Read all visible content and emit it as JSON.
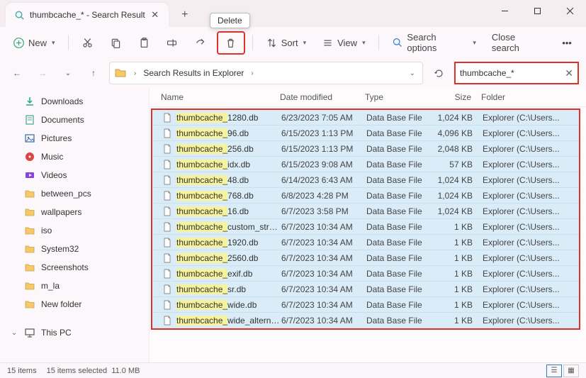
{
  "window": {
    "tab_title": "thumbcache_* - Search Result",
    "tooltip_delete": "Delete"
  },
  "toolbar": {
    "new": "New",
    "sort": "Sort",
    "view": "View",
    "search_options": "Search options",
    "close_search": "Close search"
  },
  "address": {
    "breadcrumb": "Search Results in Explorer",
    "search_query": "thumbcache_*"
  },
  "columns": {
    "name": "Name",
    "date": "Date modified",
    "type": "Type",
    "size": "Size",
    "folder": "Folder"
  },
  "sidebar": [
    {
      "label": "Downloads",
      "icon": "download"
    },
    {
      "label": "Documents",
      "icon": "doc"
    },
    {
      "label": "Pictures",
      "icon": "pic"
    },
    {
      "label": "Music",
      "icon": "music"
    },
    {
      "label": "Videos",
      "icon": "video"
    },
    {
      "label": "between_pcs",
      "icon": "folder"
    },
    {
      "label": "wallpapers",
      "icon": "folder"
    },
    {
      "label": "iso",
      "icon": "folder"
    },
    {
      "label": "System32",
      "icon": "folder"
    },
    {
      "label": "Screenshots",
      "icon": "folder"
    },
    {
      "label": "m_la",
      "icon": "folder"
    },
    {
      "label": "New folder",
      "icon": "folder"
    }
  ],
  "thispc_label": "This PC",
  "files": [
    {
      "name_hl": "thumbcache_",
      "name_rest": "1280.db",
      "date": "6/23/2023 7:05 AM",
      "type": "Data Base File",
      "size": "1,024 KB",
      "folder": "Explorer (C:\\Users..."
    },
    {
      "name_hl": "thumbcache_",
      "name_rest": "96.db",
      "date": "6/15/2023 1:13 PM",
      "type": "Data Base File",
      "size": "4,096 KB",
      "folder": "Explorer (C:\\Users..."
    },
    {
      "name_hl": "thumbcache_",
      "name_rest": "256.db",
      "date": "6/15/2023 1:13 PM",
      "type": "Data Base File",
      "size": "2,048 KB",
      "folder": "Explorer (C:\\Users..."
    },
    {
      "name_hl": "thumbcache_",
      "name_rest": "idx.db",
      "date": "6/15/2023 9:08 AM",
      "type": "Data Base File",
      "size": "57 KB",
      "folder": "Explorer (C:\\Users..."
    },
    {
      "name_hl": "thumbcache_",
      "name_rest": "48.db",
      "date": "6/14/2023 6:43 AM",
      "type": "Data Base File",
      "size": "1,024 KB",
      "folder": "Explorer (C:\\Users..."
    },
    {
      "name_hl": "thumbcache_",
      "name_rest": "768.db",
      "date": "6/8/2023 4:28 PM",
      "type": "Data Base File",
      "size": "1,024 KB",
      "folder": "Explorer (C:\\Users..."
    },
    {
      "name_hl": "thumbcache_",
      "name_rest": "16.db",
      "date": "6/7/2023 3:58 PM",
      "type": "Data Base File",
      "size": "1,024 KB",
      "folder": "Explorer (C:\\Users..."
    },
    {
      "name_hl": "thumbcache_",
      "name_rest": "custom_stream.db",
      "date": "6/7/2023 10:34 AM",
      "type": "Data Base File",
      "size": "1 KB",
      "folder": "Explorer (C:\\Users..."
    },
    {
      "name_hl": "thumbcache_",
      "name_rest": "1920.db",
      "date": "6/7/2023 10:34 AM",
      "type": "Data Base File",
      "size": "1 KB",
      "folder": "Explorer (C:\\Users..."
    },
    {
      "name_hl": "thumbcache_",
      "name_rest": "2560.db",
      "date": "6/7/2023 10:34 AM",
      "type": "Data Base File",
      "size": "1 KB",
      "folder": "Explorer (C:\\Users..."
    },
    {
      "name_hl": "thumbcache_",
      "name_rest": "exif.db",
      "date": "6/7/2023 10:34 AM",
      "type": "Data Base File",
      "size": "1 KB",
      "folder": "Explorer (C:\\Users..."
    },
    {
      "name_hl": "thumbcache_",
      "name_rest": "sr.db",
      "date": "6/7/2023 10:34 AM",
      "type": "Data Base File",
      "size": "1 KB",
      "folder": "Explorer (C:\\Users..."
    },
    {
      "name_hl": "thumbcache_",
      "name_rest": "wide.db",
      "date": "6/7/2023 10:34 AM",
      "type": "Data Base File",
      "size": "1 KB",
      "folder": "Explorer (C:\\Users..."
    },
    {
      "name_hl": "thumbcache_",
      "name_rest": "wide_alternate.db",
      "date": "6/7/2023 10:34 AM",
      "type": "Data Base File",
      "size": "1 KB",
      "folder": "Explorer (C:\\Users..."
    }
  ],
  "status": {
    "item_count": "15 items",
    "selected": "15 items selected",
    "size": "11.0 MB"
  }
}
